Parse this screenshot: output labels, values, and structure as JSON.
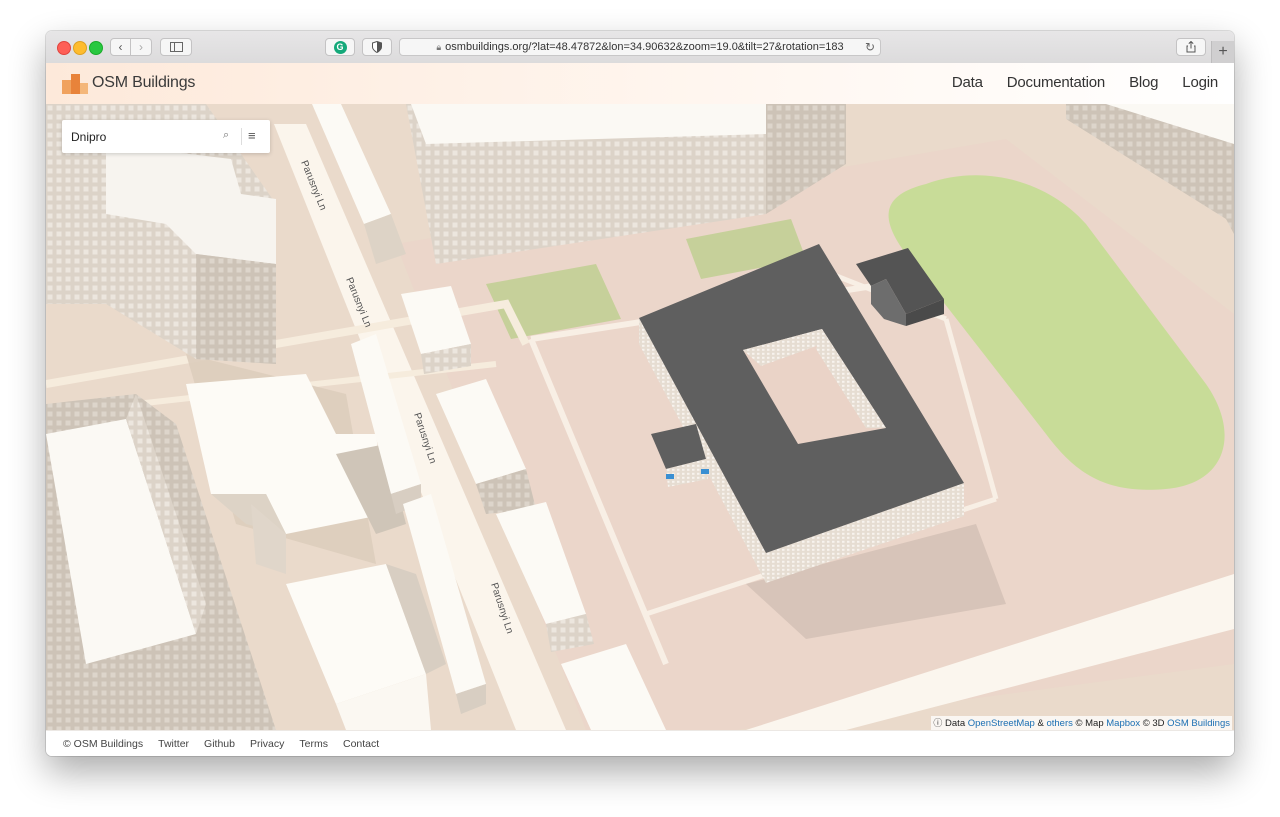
{
  "browser": {
    "url": "osmbuildings.org/?lat=48.47872&lon=34.90632&zoom=19.0&tilt=27&rotation=183",
    "extension_letter": "G",
    "new_tab_glyph": "+"
  },
  "header": {
    "brand": "OSM Buildings",
    "nav": [
      {
        "label": "Data"
      },
      {
        "label": "Documentation"
      },
      {
        "label": "Blog"
      },
      {
        "label": "Login"
      }
    ]
  },
  "search": {
    "value": "Dnipro",
    "icon": "search-icon",
    "menu_icon": "hamburger-menu-icon"
  },
  "map": {
    "street_labels": [
      "Pаrusnyi Ln",
      "Pаrusnyi Ln",
      "Pаrusnyi Ln",
      "Pаrusnyi Ln"
    ],
    "colors": {
      "ground": "#eadacb",
      "campus": "#ecd8cc",
      "road": "#f7efe3",
      "field": "#c8dc98",
      "roof": "#5f5f5f",
      "building_white": "#fdfbf6",
      "facade": "#d6cdc2"
    }
  },
  "attribution": {
    "prefix": "Data",
    "osm": "OpenStreetMap",
    "amp": "&",
    "others": "others",
    "map_prefix": "© Map",
    "mapbox": "Mapbox",
    "prefix3d": "© 3D",
    "osmb": "OSM Buildings"
  },
  "footer": {
    "copyright": "© OSM Buildings",
    "links": [
      "Twitter",
      "Github",
      "Privacy",
      "Terms",
      "Contact"
    ]
  }
}
